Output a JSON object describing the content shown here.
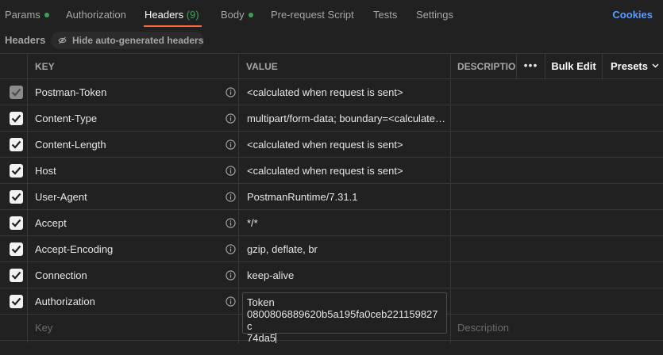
{
  "tabs": {
    "params": "Params",
    "authorization": "Authorization",
    "headers_label": "Headers",
    "headers_count": "(9)",
    "body": "Body",
    "prerequest": "Pre-request Script",
    "tests": "Tests",
    "settings": "Settings",
    "cookies": "Cookies",
    "active": "Headers"
  },
  "toolbar": {
    "title": "Headers",
    "hide_button": "Hide auto-generated headers"
  },
  "columns": {
    "key": "KEY",
    "value": "VALUE",
    "description": "DESCRIPTIO",
    "more": "•••",
    "bulk_edit": "Bulk Edit",
    "presets": "Presets"
  },
  "rows": [
    {
      "key": "Postman-Token",
      "value": "<calculated when request is sent>",
      "checked": true,
      "disabled": true
    },
    {
      "key": "Content-Type",
      "value": "multipart/form-data; boundary=<calculated when request is sent>",
      "checked": true,
      "disabled": false
    },
    {
      "key": "Content-Length",
      "value": "<calculated when request is sent>",
      "checked": true,
      "disabled": false
    },
    {
      "key": "Host",
      "value": "<calculated when request is sent>",
      "checked": true,
      "disabled": false
    },
    {
      "key": "User-Agent",
      "value": "PostmanRuntime/7.31.1",
      "checked": true,
      "disabled": false
    },
    {
      "key": "Accept",
      "value": "*/*",
      "checked": true,
      "disabled": false
    },
    {
      "key": "Accept-Encoding",
      "value": "gzip, deflate, br",
      "checked": true,
      "disabled": false
    },
    {
      "key": "Connection",
      "value": "keep-alive",
      "checked": true,
      "disabled": false
    },
    {
      "key": "Authorization",
      "value": "Token 0800806889620b5a195fa0ceb221159827c74da5",
      "checked": true,
      "disabled": false
    }
  ],
  "editing_value": {
    "line1": "Token",
    "line2": "0800806889620b5a195fa0ceb221159827c",
    "line3": "74da5"
  },
  "new_row": {
    "key_placeholder": "Key",
    "description_placeholder": "Description"
  },
  "colors": {
    "background": "#212121",
    "accent_orange": "#ff6c37",
    "status_green": "#3ca257",
    "link_blue": "#5c9bff"
  }
}
